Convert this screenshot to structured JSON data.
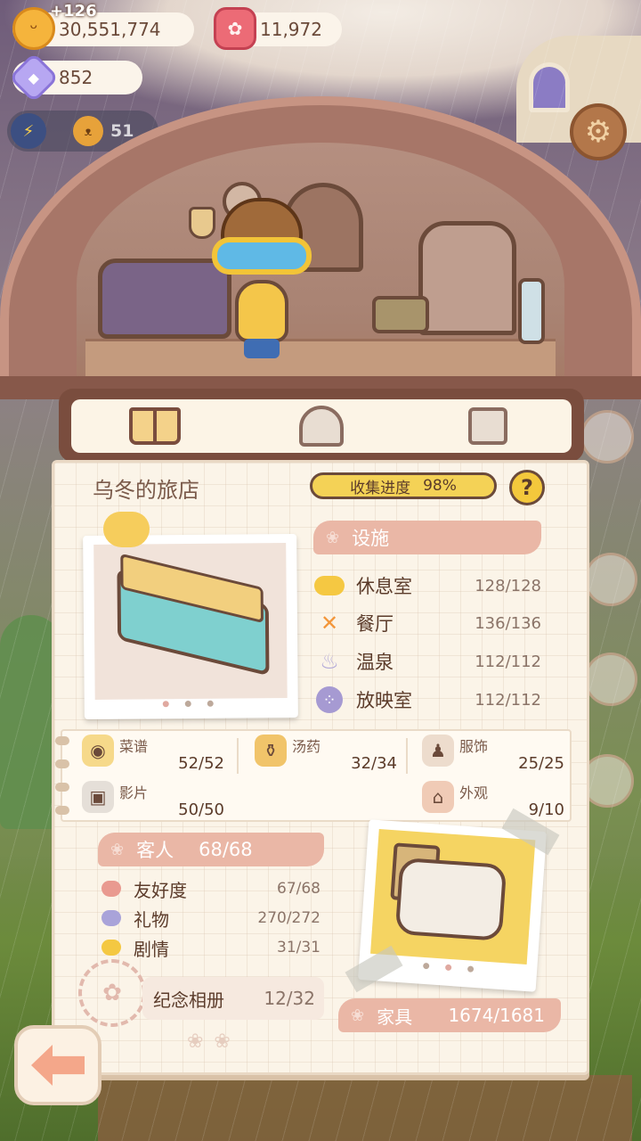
{
  "currencies": {
    "coins": "30,551,774",
    "coins_gain": "+126",
    "gems": "11,972",
    "crystals": "852"
  },
  "weather": {
    "count": "51"
  },
  "tabs": [
    {
      "name": "book-icon"
    },
    {
      "name": "hotel-icon"
    },
    {
      "name": "shirt-icon"
    }
  ],
  "panel": {
    "title": "乌冬的旅店",
    "progress_label": "收集进度",
    "progress_value": "98%",
    "help": "?"
  },
  "facilities": {
    "banner": "设施",
    "items": [
      {
        "label": "休息室",
        "value": "128/128",
        "icon": "cloud-icon"
      },
      {
        "label": "餐厅",
        "value": "136/136",
        "icon": "fork-knife-icon"
      },
      {
        "label": "温泉",
        "value": "112/112",
        "icon": "hot-spring-icon"
      },
      {
        "label": "放映室",
        "value": "112/112",
        "icon": "film-reel-icon"
      }
    ]
  },
  "collections": [
    {
      "label": "菜谱",
      "value": "52/52",
      "icon": "recipe-icon"
    },
    {
      "label": "汤药",
      "value": "32/34",
      "icon": "potion-icon"
    },
    {
      "label": "服饰",
      "value": "25/25",
      "icon": "outfit-icon"
    },
    {
      "label": "影片",
      "value": "50/50",
      "icon": "camera-icon"
    },
    {
      "label": "外观",
      "value": "9/10",
      "icon": "exterior-icon"
    }
  ],
  "guests": {
    "banner_label": "客人",
    "banner_value": "68/68",
    "items": [
      {
        "label": "友好度",
        "value": "67/68",
        "color": "#e99a90"
      },
      {
        "label": "礼物",
        "value": "270/272",
        "color": "#a9a3d9"
      },
      {
        "label": "剧情",
        "value": "31/31",
        "color": "#f4c842"
      }
    ]
  },
  "album": {
    "label": "纪念相册",
    "value": "12/32"
  },
  "furniture": {
    "label": "家具",
    "value": "1674/1681"
  },
  "colors": {
    "banner": "#eab7a6",
    "progress": "#f4d256",
    "panel": "#fbf4e8",
    "frame": "#7a4d3e"
  }
}
